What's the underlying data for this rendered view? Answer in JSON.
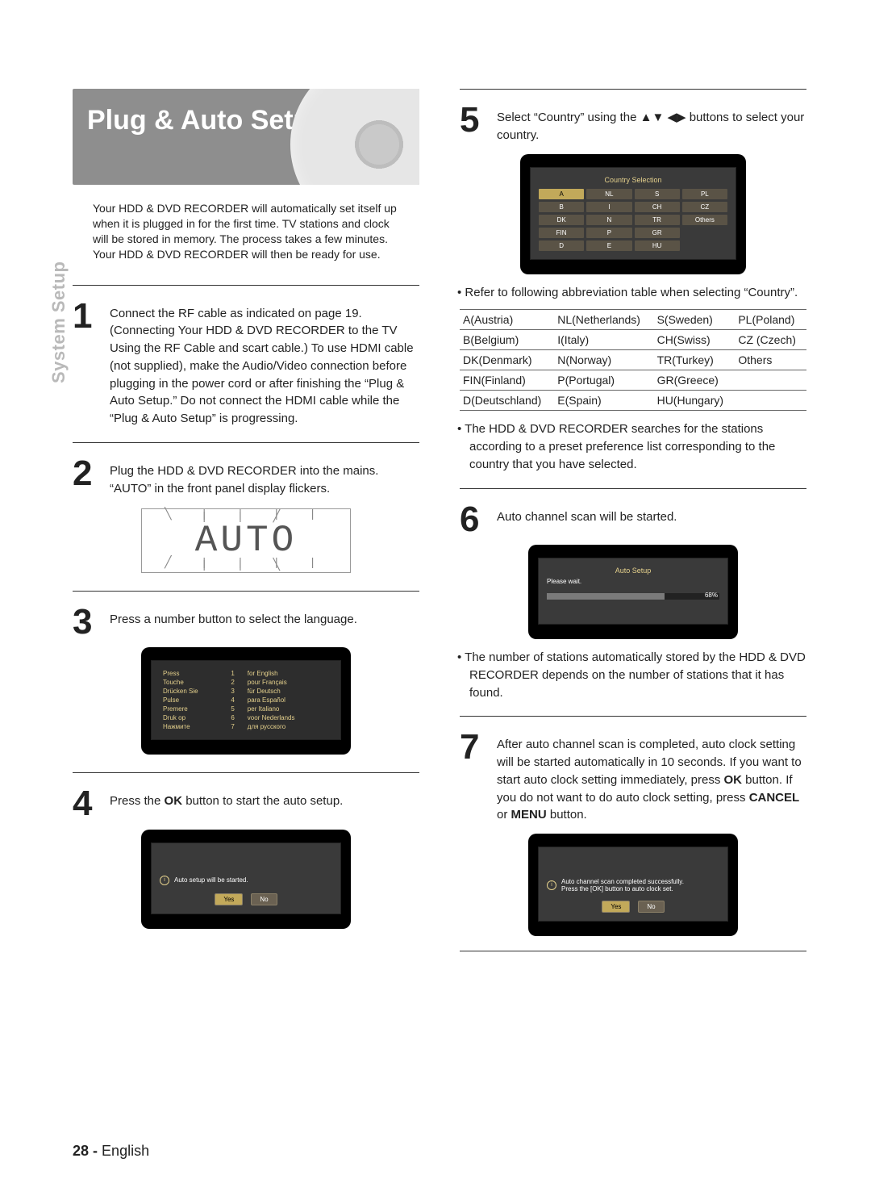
{
  "sideTab": "System Setup",
  "title": "Plug & Auto Setup",
  "intro": "Your HDD & DVD RECORDER will automatically set itself up when it is plugged in for the first time. TV stations and clock will be stored in memory. The process takes a few minutes. Your HDD & DVD RECORDER will then be ready for use.",
  "steps": {
    "1": "Connect the RF cable as indicated on page 19. (Connecting Your HDD & DVD RECORDER to the TV Using the RF Cable and scart cable.) To use HDMI cable (not supplied), make the Audio/Video connection before plugging in the power cord or after finishing the “Plug & Auto Setup.” Do not connect the HDMI cable while the “Plug & Auto Setup” is progressing.",
    "2": "Plug the HDD & DVD RECORDER into the mains. “AUTO” in the front panel display flickers.",
    "3": "Press a number button to select the language.",
    "4_pre": "Press the ",
    "4_post": " button to start the auto setup.",
    "ok": "OK",
    "5_pre": "Select “Country” using the ",
    "5_arrows": "▲▼ ◀▶",
    "5_post": " buttons to select your country.",
    "6": "Auto channel scan will be started.",
    "7_pre": "After auto channel scan is completed, auto clock setting will be started automatically in 10 seconds. If you want to start auto clock setting immediately, press ",
    "7_mid": " button. If you do not want to do auto clock setting, press ",
    "cancel": "CANCEL",
    "or": " or ",
    "menu": "MENU",
    "7_post": " button."
  },
  "notes": {
    "abbr": "Refer to following abbreviation table when selecting “Country”.",
    "search": "The HDD & DVD RECORDER searches for the stations according to a preset preference list corresponding to the country that you have selected.",
    "stations": "The number of stations automatically stored by the HDD & DVD RECORDER depends on the number of stations that it has found."
  },
  "seg7": {
    "word": "AUTO"
  },
  "tv": {
    "lang": {
      "rows": [
        [
          "Press",
          "1",
          "for English"
        ],
        [
          "Touche",
          "2",
          "pour Français"
        ],
        [
          "Drücken Sie",
          "3",
          "für Deutsch"
        ],
        [
          "Pulse",
          "4",
          "para Español"
        ],
        [
          "Premere",
          "5",
          "per Italiano"
        ],
        [
          "Druk op",
          "6",
          "voor Nederlands"
        ],
        [
          "Нажмите",
          "7",
          "для русского"
        ]
      ]
    },
    "start": {
      "msg": "Auto setup will be started.",
      "yes": "Yes",
      "no": "No"
    },
    "country": {
      "header": "Country Selection",
      "grid": [
        [
          "A",
          "NL",
          "S",
          "PL"
        ],
        [
          "B",
          "I",
          "CH",
          "CZ"
        ],
        [
          "DK",
          "N",
          "TR",
          "Others"
        ],
        [
          "FIN",
          "P",
          "GR",
          ""
        ],
        [
          "D",
          "E",
          "HU",
          ""
        ]
      ],
      "highlight": "A"
    },
    "scan": {
      "header": "Auto Setup",
      "wait": "Please wait.",
      "pct": "68%"
    },
    "done": {
      "line1": "Auto channel scan completed successfully.",
      "line2": "Press the [OK] button to auto clock set.",
      "yes": "Yes",
      "no": "No"
    }
  },
  "abbrTable": [
    [
      "A(Austria)",
      "NL(Netherlands)",
      "S(Sweden)",
      "PL(Poland)"
    ],
    [
      "B(Belgium)",
      "I(Italy)",
      "CH(Swiss)",
      "CZ (Czech)"
    ],
    [
      "DK(Denmark)",
      "N(Norway)",
      "TR(Turkey)",
      "Others"
    ],
    [
      "FIN(Finland)",
      "P(Portugal)",
      "GR(Greece)",
      ""
    ],
    [
      "D(Deutschland)",
      "E(Spain)",
      "HU(Hungary)",
      ""
    ]
  ],
  "footer": {
    "page": "28 -",
    "lang": "English"
  }
}
